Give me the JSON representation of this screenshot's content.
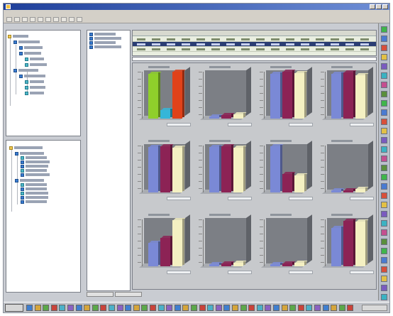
{
  "window": {
    "title": ""
  },
  "menu": {
    "items": [
      "",
      "",
      "",
      "",
      "",
      ""
    ]
  },
  "toolbar": {
    "button_count": 10
  },
  "charts": [
    {
      "bars": [
        {
          "color": "#8fcf2b",
          "level": 0.95
        },
        {
          "color": "#35b6d8",
          "level": 0.18
        },
        {
          "color": "#e0421a",
          "level": 1.0
        }
      ]
    },
    {
      "bars": [
        {
          "color": "#7a89d6",
          "level": 0.05
        },
        {
          "color": "#8c2355",
          "level": 0.07
        },
        {
          "color": "#f4f0c2",
          "level": 0.09
        }
      ]
    },
    {
      "bars": [
        {
          "color": "#7a89d6",
          "level": 0.95
        },
        {
          "color": "#8c2355",
          "level": 1.0
        },
        {
          "color": "#f4f0c2",
          "level": 0.97
        }
      ]
    },
    {
      "bars": [
        {
          "color": "#7a89d6",
          "level": 0.95
        },
        {
          "color": "#8c2355",
          "level": 0.98
        },
        {
          "color": "#f4f0c2",
          "level": 0.93
        }
      ]
    },
    {
      "bars": [
        {
          "color": "#7a89d6",
          "level": 0.97
        },
        {
          "color": "#8c2355",
          "level": 0.98
        },
        {
          "color": "#f4f0c2",
          "level": 0.96
        }
      ]
    },
    {
      "bars": [
        {
          "color": "#7a89d6",
          "level": 0.97
        },
        {
          "color": "#8c2355",
          "level": 0.99
        },
        {
          "color": "#f4f0c2",
          "level": 0.95
        }
      ]
    },
    {
      "bars": [
        {
          "color": "#7a89d6",
          "level": 0.98
        },
        {
          "color": "#8c2355",
          "level": 0.4
        },
        {
          "color": "#f4f0c2",
          "level": 0.36
        }
      ]
    },
    {
      "bars": [
        {
          "color": "#7a89d6",
          "level": 0.04
        },
        {
          "color": "#8c2355",
          "level": 0.05
        },
        {
          "color": "#f4f0c2",
          "level": 0.07
        }
      ]
    },
    {
      "bars": [
        {
          "color": "#7a89d6",
          "level": 0.5
        },
        {
          "color": "#8c2355",
          "level": 0.6
        },
        {
          "color": "#f4f0c2",
          "level": 0.98
        }
      ]
    },
    {
      "bars": [
        {
          "color": "#7a89d6",
          "level": 0.05
        },
        {
          "color": "#8c2355",
          "level": 0.06
        },
        {
          "color": "#f4f0c2",
          "level": 0.08
        }
      ]
    },
    {
      "bars": [
        {
          "color": "#7a89d6",
          "level": 0.05
        },
        {
          "color": "#8c2355",
          "level": 0.06
        },
        {
          "color": "#f4f0c2",
          "level": 0.07
        }
      ]
    },
    {
      "bars": [
        {
          "color": "#7a89d6",
          "level": 0.82
        },
        {
          "color": "#8c2355",
          "level": 0.97
        },
        {
          "color": "#f4f0c2",
          "level": 0.95
        }
      ]
    }
  ],
  "colors": {
    "titlebar": "#1e3f9a",
    "bar_blue": "#7a89d6",
    "bar_maroon": "#8c2355",
    "bar_cream": "#f4f0c2",
    "bar_green": "#8fcf2b",
    "bar_cyan": "#35b6d8",
    "bar_red": "#e0421a"
  },
  "taskbar": {
    "start_label": "",
    "clock": ""
  }
}
